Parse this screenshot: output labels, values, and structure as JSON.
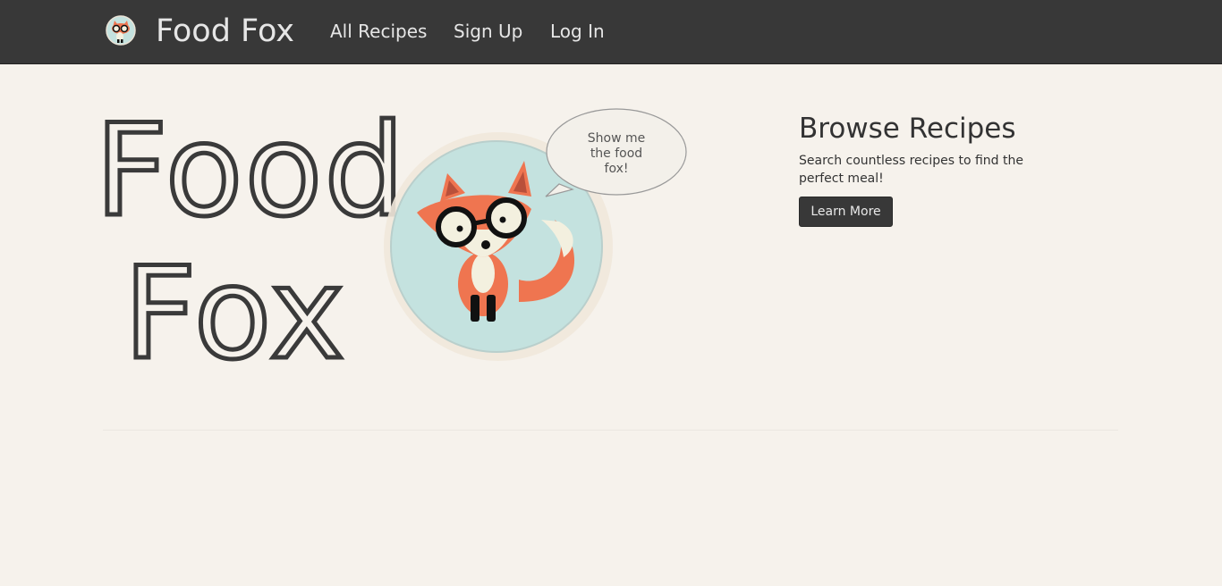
{
  "nav": {
    "brand": "Food Fox",
    "links": [
      {
        "label": "All Recipes"
      },
      {
        "label": "Sign Up"
      },
      {
        "label": "Log In"
      }
    ]
  },
  "hero": {
    "logo_line1": "Food",
    "logo_line2": "Fox",
    "speech_bubble": [
      "Show me",
      "the food",
      "fox!"
    ],
    "mascot": "fox-with-glasses-icon"
  },
  "browse": {
    "title": "Browse Recipes",
    "description": "Search countless recipes to find the perfect meal!",
    "button_label": "Learn More"
  },
  "colors": {
    "navbar_bg": "#383838",
    "page_bg": "#f6f2ec",
    "fox_orange": "#ef7550",
    "badge_teal": "#c4e2df"
  }
}
